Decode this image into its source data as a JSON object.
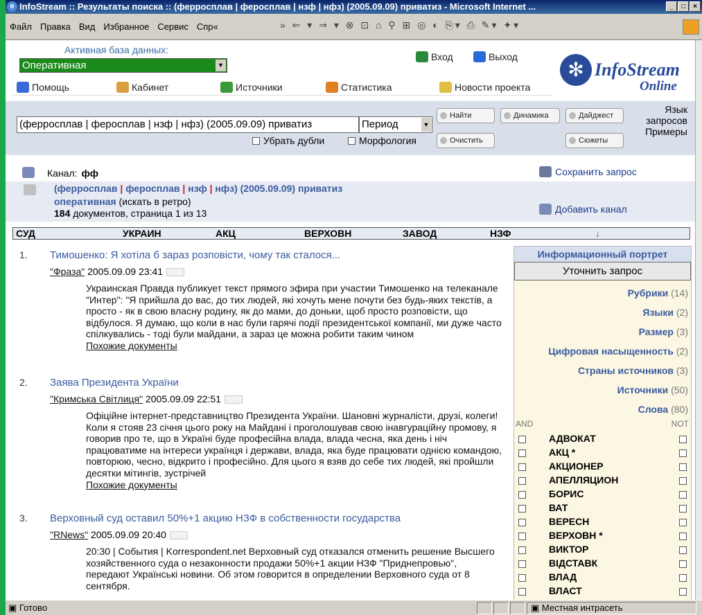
{
  "window": {
    "title": "InfoStream :: Результаты поиска :: (ферросплав | феросплав | нзф | нфз) (2005.09.09) приватиз - Microsoft Internet ..."
  },
  "menu": [
    "Файл",
    "Правка",
    "Вид",
    "Избранное",
    "Сервис",
    "Спр«"
  ],
  "header": {
    "db_label": "Активная база данных:",
    "db_value": "Оперативная",
    "login": "Вход",
    "logout": "Выход",
    "logo_word": "InfoStream",
    "logo_online": "Online",
    "nav": [
      "Помощь",
      "Кабинет",
      "Источники",
      "Статистика",
      "Новости проекта"
    ]
  },
  "search": {
    "query": "(ферросплав | феросплав | нзф | нфз) (2005.09.09) приватиз",
    "period": "Период",
    "dedup": "Убрать дубли",
    "morph": "Морфология",
    "btn_find": "Найти",
    "btn_dynamics": "Динамика",
    "btn_digest": "Дайджест",
    "btn_clear": "Очистить",
    "btn_plots": "Сюжеты",
    "lang_text": "Язык запросов Примеры"
  },
  "channel": {
    "label": "Канал:",
    "name": "фф",
    "save": "Сохранить запрос",
    "add": "Добавить канал",
    "q_terms": [
      "(ферросплав",
      "феросплав",
      "нзф",
      "нфз)"
    ],
    "q_date": "(2005.09.09)",
    "q_tail": "приватиз",
    "db": "оперативная",
    "retro": "(искать в ретро)",
    "count": "184",
    "count_text": "документов, страница 1 из 13"
  },
  "words_bar": [
    "СУД",
    "УКРАИН",
    "АКЦ",
    "ВЕРХОВН",
    "ЗАВОД",
    "НЗФ",
    "↓"
  ],
  "results": [
    {
      "num": "1.",
      "title": "Тимошенко: Я хотіла б зараз розповісти, чому так сталося...",
      "source": "\"Фраза\"",
      "date": "2005.09.09 23:41",
      "body": "Украинская Правда публикует текст прямого эфира при участии Тимошенко на телеканале \"Интер\": \"Я прийшла до вас, до тих людей, які хочуть мене почути без будь-яких текстів, а просто - як в свою власну родину, як до мами, до доньки, щоб просто розповісти, що відбулося. Я думаю, що коли в нас були гарячі події президентської компанії, ми дуже часто спілкувались - тоді були майдани, а зараз це можна робити таким чином",
      "similar": "Похожие документы"
    },
    {
      "num": "2.",
      "title": "Заява Президента України",
      "source": "\"Кримська Світлиця\"",
      "date": "2005.09.09 22:51",
      "body": "Офіційне інтернет-представництво Президента України. Шановні журналісти, друзі, колеги! Коли я стояв 23 січня цього року на Майдані і проголошував свою інавгураційну промову, я говорив про те, що в Україні буде професійна влада, влада чесна, яка день і ніч працюватиме на інтереси українця і держави, влада, яка буде працювати однією командою, повторюю, чесно, відкрито і професійно. Для цього я взяв до себе тих людей, які пройшли десятки мітингів, зустрічей",
      "similar": "Похожие документы"
    },
    {
      "num": "3.",
      "title": "Верховный суд оставил 50%+1 акцию НЗФ в собственности государства",
      "source": "\"RNews\"",
      "date": "2005.09.09 20:40",
      "body": "20:30 | События | Korrespondent.net Верховный суд отказался отменить решение Высшего хозяйственного суда о незаконности продажи 50%+1 акции НЗФ \"Приднепровью\", передают Українські новини. Об этом говорится в определении Верховного суда от 8 сентября.",
      "similar": ""
    }
  ],
  "panel": {
    "title": "Информационный портрет",
    "refine": "Уточнить запрос",
    "rubrics": [
      {
        "name": "Рубрики",
        "count": "(14)"
      },
      {
        "name": "Языки",
        "count": "(2)"
      },
      {
        "name": "Размер",
        "count": "(3)"
      },
      {
        "name": "Цифровая насыщенность",
        "count": "(2)"
      },
      {
        "name": "Страны источников",
        "count": "(3)"
      },
      {
        "name": "Источники",
        "count": "(50)"
      },
      {
        "name": "Слова",
        "count": "(80)"
      }
    ],
    "and": "AND",
    "not": "NOT",
    "words": [
      "АДВОКАТ",
      "АКЦ *",
      "АКЦИОНЕР",
      "АПЕЛЛЯЦИОН",
      "БОРИС",
      "ВАТ",
      "ВЕРЕСН",
      "ВЕРХОВН *",
      "ВИКТОР",
      "ВІДСТАВК",
      "ВЛАД",
      "ВЛАСТ"
    ]
  },
  "status": {
    "ready": "Готово",
    "zone": "Местная интрасеть"
  }
}
